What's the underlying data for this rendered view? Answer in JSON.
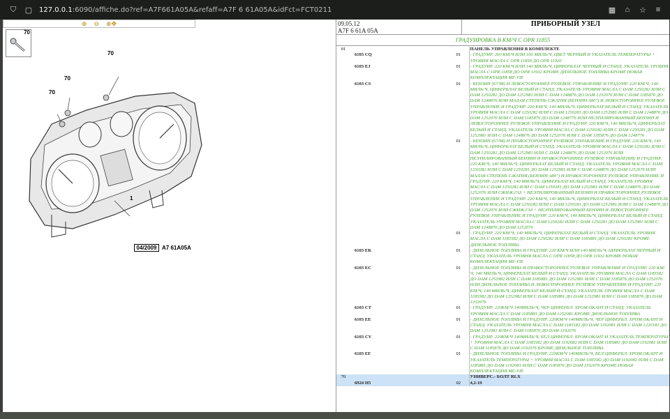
{
  "browser": {
    "url_host": "127.0.0.1",
    "url_rest": ":6090/affiche.do?ref=A7F661A05A&refaff=A7F 6 61A05A&idFct=FCT0211"
  },
  "left": {
    "thumb_number": "70",
    "callouts": [
      "70",
      "70",
      "70",
      "1"
    ],
    "date": "04/2009",
    "ref_code": "A7 61A05A"
  },
  "right": {
    "header": {
      "date": "09.05.12",
      "ref": "A7F 6 61A 05A",
      "title": "ПРИБОРНЫЙ УЗЕЛ"
    },
    "subtitle": "ГРАДУИРОВКА В КМ/Ч С OPR 11855",
    "rows": [
      {
        "c1": "01",
        "c2": "",
        "c3": "",
        "c4": "ПАНЕЛЬ УПРАВЛЕНИЯ В КОМПЛЕКТЕ",
        "kind": "title"
      },
      {
        "c1": "",
        "c2": "6103 CQ",
        "c3": "01",
        "c4": "- ГРАДУИР. 260 КМ/Ч ИЛИ 160 МИЛЬ/Ч, ЦВЕТ ЧЕРНЫЙ И УКАЗАТЕЛЬ ТЕМПЕРАТУРЫ + УРОВНЯ МАСЛА С OPR 11858 ДО OPR 11920"
      },
      {
        "c1": "",
        "c2": "6103 EJ",
        "c3": "01",
        "c4": "- ГРАДУИР. 220 КМ/Ч ИЛИ 140 МИЛЬ/Ч, ЦИФЕРБЛАТ ЧЕРНЫЙ И СТАНД. УКАЗАТЕЛЬ УРОВНЯ МАСЛА С OPR 11858 ДО OPR 11932 КРОМЕ ДИЗЕЛЬНОЕ ТОПЛИВА КРОМЕ НОВАЯ КОМПЛЕКТАЦИЯ МЕ-VIE"
      },
      {
        "c1": "",
        "c2": "6103 CS",
        "c3": "01",
        "c4": "- БЕНЗИН (67/98) И ЛЕВОСТОРОННЕЕ РУЛЕВОЕ УПРАВЛЕНИЕ И ГРАДУИР. 220 КМ/Ч, 140 МИЛЬ/Ч, ЦИФЕРБЛАТ БЕЛЫЙ И СТАНД. УКАЗАТЕЛЬ УРОВНЯ МАСЛА С DAM 1250282 ИЛИ С DAM 1250281 ДО DAM 1252981 ИЛИ С DAM 1248876 ДО DAM 1252076 ИЛИ С DAM 1185876 ДО DAM 1248876 ИЛИ МАЛАЯ СТЕПЕНЬ СЖАТИЯ (БЕНЗИН А80\") И ЛЕВОСТОРОННЕЕ РУЛЕВОЕ УПРАВЛЕНИЕ И ГРАДУИР. 220 КМ/Ч, 140 МИЛЬ/Ч, ЦИФЕРБЛАТ БЕЛЫЙ И СТАНД. УКАЗАТЕЛЬ УРОВНЯ МАСЛА С DAM 1250282 ИЛИ С DAM 1250281 ДО DAM 1252981 ИЛИ С DAM 1248876 ДО DAM 1252076 ИЛИ С DAM 1185876 ДО DAM 1248776 ИЛИ НЕЭТИЛИРОВАННЫЙ БЕНЗИН И ЛЕВОСТОРОННЕЕ РУЛЕВОЕ УПРАВЛЕНИЕ И ГРАДУИР. 220 КМ/Ч, 140 МИЛЬ/Ч, ЦИФЕРБЛАТ БЕЛЫЙ И СТАНД. УКАЗАТЕЛЬ УРОВНЯ МАСЛА С DAM 1250282 ИЛИ С DAM 1250281 ДО DAM 1252981 ИЛИ С DAM 1248876 ДО DAM 1252076 ИЛИ С DAM 1185876 ДО DAM 1248776"
      },
      {
        "c1": "",
        "c2": "",
        "c3": "01",
        "c4": "- БЕНЗИН (67/98) И ПРАВОСТОРОННЕЕ РУЛЕВОЕ УПРАВЛЕНИЕ И ГРАДУИР. 220 КМ/Ч, 140 МИЛЬ/Ч, ЦИФЕРБЛАТ БЕЛЫЙ И СТАНД. УКАЗАТЕЛЬ УРОВНЯ МАСЛА С DAM 1250282 ИЛИ С DAM 1250281 ДО DAM 1252981 ИЛИ С DAM 1248876 ДО DAM 1252076 ИЛИ НЕЭТИЛИРОВАННЫЙ БЕНЗИН И ПРАВОСТОРОННЕЕ РУЛЕВОЕ УПРАВЛЕНИЕ И ГРАДУИР. 220 КМ/Ч, 140 МИЛЬ/Ч, ЦИФЕРБЛАТ БЕЛЫЙ И СТАНД. УКАЗАТЕЛЬ УРОВНЯ МАСЛА С DAM 1250282 ИЛИ С DAM 1250281 ДО DAM 1252981 ИЛИ С DAM 1248876 ДО DAM 1252076 ИЛИ МАЛАЯ СТЕПЕНЬ СЖАТИЯ (БЕНЗИН А80\") И ПРАВОСТОРОННЕЕ РУЛЕВОЕ УПРАВЛЕНИЕ И ГРАДУИР. 220 КМ/Ч, 140 МИЛЬ/Ч, ЦИФЕРБЛАТ БЕЛЫЙ И СТАНД. УКАЗАТЕЛЬ УРОВНЯ МАСЛА С DAM 1250282 ИЛИ С DAM 1250281 ДО DAM 1252981 ИЛИ С DAM 1248876 ДО DAM 1252076 ИЛИ СЖИЖ.ГАЗ + НЕЭТИЛИРОВАННЫЙ БЕНЗИН И ПРАВОСТОРОННЕЕ РУЛЕВОЕ УПРАВЛЕНИЕ И ГРАДУИР. 220 КМ/Ч, 140 МИЛЬ/Ч, ЦИФЕРБЛАТ БЕЛЫЙ И СТАНД. УКАЗАТЕЛЬ УРОВНЯ МАСЛА С DAM 1250282 ИЛИ С DAM 1250281 ДО DAM 1252981 ИЛИ С DAM 1248876 ДО DAM 1252076 ИЛИ СЖИЖ.ГАЗ + НЕЭТИЛИРОВАННЫЙ БЕНЗИН И ЛЕВОСТОРОННЕЕ РУЛЕВОЕ УПРАВЛЕНИЕ И ГРАДУИР. 220 КМ/Ч, 140 МИЛЬ/Ч, ЦИФЕРБЛАТ БЕЛЫЙ И СТАНД. УКАЗАТЕЛЬ УРОВНЯ МАСЛА С DAM 1250282 ИЛИ С DAM 1250281 ДО DAM 1252981 ИЛИ С DAM 1248876 ДО DAM 1252076"
      },
      {
        "c1": "",
        "c2": "",
        "c3": "01",
        "c4": "- ГРАДУИР. 220 КМ/Ч, 140 МИЛЬ/Ч, ЦИФЕРБЛАТ БЕЛЫЙ И СТАНД. УКАЗАТЕЛЬ УРОВНЯ МАСЛА С DAM 1185582 ДО DAM 1250282 ИЛИ С DAM 1185881 ДО DAM 1250281 КРОМЕ ДИЗЕЛЬНОЕ ТОПЛИВА"
      },
      {
        "c1": "",
        "c2": "6103 EK",
        "c3": "01",
        "c4": "- ДИЗЕЛЬНОЕ ТОПЛИВА И ГРАДУИР. 220 КМ/Ч ИЛИ 140 МИЛЬ/Ч, ЦИФЕРБЛАТ ЧЕРНЫЙ И СТАНД. УКАЗАТЕЛЬ УРОВНЯ МАСЛА С OPR 11858 ДО OPR 11932 КРОМЕ НОВАЯ КОМПЛЕКТАЦИЯ МЕ-VIE"
      },
      {
        "c1": "",
        "c2": "6103 EC",
        "c3": "01",
        "c4": "- ДИЗЕЛЬНОЕ ТОПЛИВА И ПРАВОСТОРОННЕЕ РУЛЕВОЕ УПРАВЛЕНИЕ И ГРАДУИР. 220 КМ/Ч, 140 МИЛЬ/Ч, ЦИФЕРБЛАТ БЕЛЫЙ И СТАНД. УКАЗАТЕЛЬ УРОВНЯ МАСЛА С DAM 1185582 ДО DAM 1252982 ИЛИ С DAM 1185881 ДО DAM 1252981 ИЛИ С DAM 1185876 ДО DAM 1252076 ИЛИ ДИЗЕЛЬНОЕ ТОПЛИВА И ЛЕВОСТОРОННЕЕ РУЛЕВОЕ УПРАВЛЕНИЕ И ГРАДУИР. 220 КМ/Ч, 140 МИЛЬ/Ч, ЦИФЕРБЛАТ БЕЛЫЙ И СТАНД. УКАЗАТЕЛЬ УРОВНЯ МАСЛА С DAM 1185582 ДО DAM 1252982 ИЛИ С DAM 1185881 ДО DAM 1252981 ИЛИ С DAM 1185876 ДО DAM 1252076"
      },
      {
        "c1": "",
        "c2": "6103 CT",
        "c3": "01",
        "c4": "- ГРАДУИР. 220КМ/Ч 140МИЛЬ/Ч, ЧЕР ЦИФЕРБЛ. ХРОМ.ОКАНТ И СТАНД. УКАЗАТЕЛЬ УРОВНЯ МАСЛА С DAM 1185881 ДО DAM 1252081 КРОМЕ ДИЗЕЛЬНОЕ ТОПЛИВА"
      },
      {
        "c1": "",
        "c2": "6103 EE",
        "c3": "01",
        "c4": "- ДИЗЕЛЬНОЕ ТОПЛИВА И ГРАДУИР. 220КМ/Ч 140МИЛЬ/Ч, ЧЕР ЦИФЕРБЛ. ХРОМ.ОКАНТ И СТАНД. УКАЗАТЕЛЬ УРОВНЯ МАСЛА С DAM 1185182 ДО DAM 1192081 ИЛИ С DAM 1220181 ДО DAM 1252081 ИЛИ С DAM 1185876 ДО DAM 1192076"
      },
      {
        "c1": "",
        "c2": "6103 CV",
        "c3": "01",
        "c4": "- ГРАДУИР. 220КМ/Ч 140МИЛЬ/Ч, БЕЛ ЦИФЕРБЛ. ХРОМ.ОКАНТ И УКАЗАТЕЛЬ ТЕМПЕРАТУРЫ + УРОВНЯ МАСЛА С DAM 1185582 ДО DAM 1192082 ИЛИ С DAM 1185881 ДО DAM 1192081 ИЛИ С DAM 1185876 ДО DAM 1192076 КРОМЕ ДИЗЕЛЬНОЕ ТОПЛИВА"
      },
      {
        "c1": "",
        "c2": "6103 EF",
        "c3": "01",
        "c4": "- ДИЗЕЛЬНОЕ ТОПЛИВА И ГРАДУИР. 220КМ/Ч 140МИЛЬ/Ч, БЕЛ ЦИФЕРБЛ. ХРОМ.ОКАНТ И УКАЗАТЕЛЬ ТЕМПЕРАТУРЫ + УРОВНЯ МАСЛА С DAM 1185582 ДО DAM 1192082 ИЛИ С DAM 1185881 ДО DAM 1192081 ИЛИ С DAM 1185876 ДО DAM 1192076 КРОМЕ НОВАЯ КОМПЛЕКТАЦИЯ МЕ-VIE"
      },
      {
        "c1": "70",
        "c2": "",
        "c3": "",
        "c4": "УНИВЕРС.- БОЛТ RLX",
        "kind": "hl"
      },
      {
        "c1": "",
        "c2": "6924 H5",
        "c3": "02",
        "c4": "4,2-19",
        "kind": "hl2"
      }
    ]
  }
}
